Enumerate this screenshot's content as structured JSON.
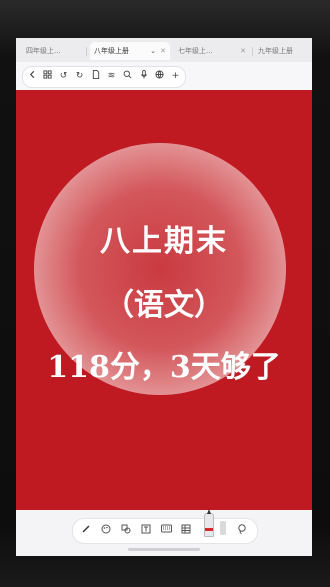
{
  "tabs": [
    {
      "label": "四年级上..."
    },
    {
      "label": "八年级上册",
      "active": true
    },
    {
      "label": "七年级上..."
    },
    {
      "label": "九年级上册"
    }
  ],
  "icons": {
    "toolbar": [
      "back-icon",
      "grid-icon",
      "undo-icon",
      "redo-icon",
      "document-icon",
      "layers-icon",
      "search-icon",
      "microphone-icon",
      "globe-icon",
      "plus-icon"
    ],
    "dock": [
      "pen-tool-icon",
      "palette-icon",
      "shapes-icon",
      "text-box-icon",
      "keyboard-icon",
      "table-icon",
      "marker-pen-icon",
      "highlighter-icon",
      "lasso-icon"
    ]
  },
  "content": {
    "line1": "八上期末",
    "line2": "（语文）",
    "line3": "118分，3天够了"
  },
  "colors": {
    "page": "#bf1a22",
    "text": "#ffffff"
  }
}
